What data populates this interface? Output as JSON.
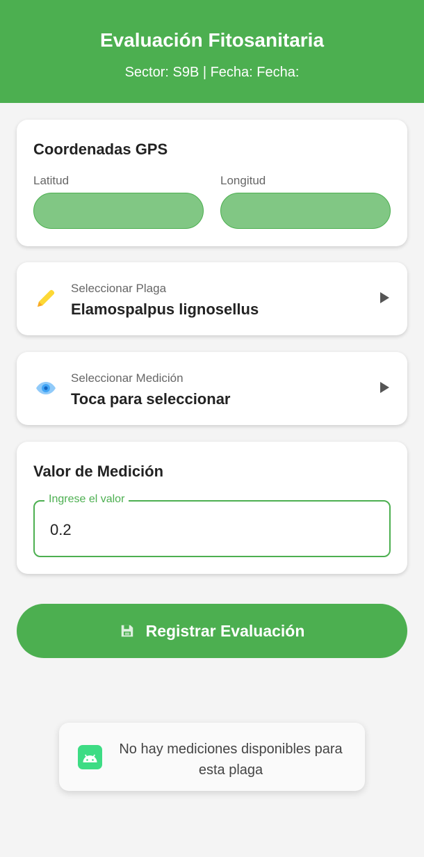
{
  "header": {
    "title": "Evaluación Fitosanitaria",
    "subtitle": "Sector: S9B | Fecha: Fecha:"
  },
  "gps": {
    "title": "Coordenadas GPS",
    "lat_label": "Latitud",
    "lat_value": "",
    "lon_label": "Longitud",
    "lon_value": ""
  },
  "plaga": {
    "label": "Seleccionar Plaga",
    "value": "Elamospalpus lignosellus",
    "icon": "pencil-icon"
  },
  "medicion": {
    "label": "Seleccionar Medición",
    "value": "Toca para seleccionar",
    "icon": "eye-icon"
  },
  "valor": {
    "title": "Valor de Medición",
    "field_label": "Ingrese el valor",
    "value": "0.2"
  },
  "register_button": {
    "label": "Registrar Evaluación",
    "icon": "save-icon"
  },
  "toast": {
    "message": "No hay mediciones disponibles para esta plaga",
    "icon": "android-icon"
  },
  "colors": {
    "primary": "#4caf50",
    "field_fill": "#81c784",
    "background": "#f4f4f4",
    "toast_icon": "#3ddc84"
  }
}
